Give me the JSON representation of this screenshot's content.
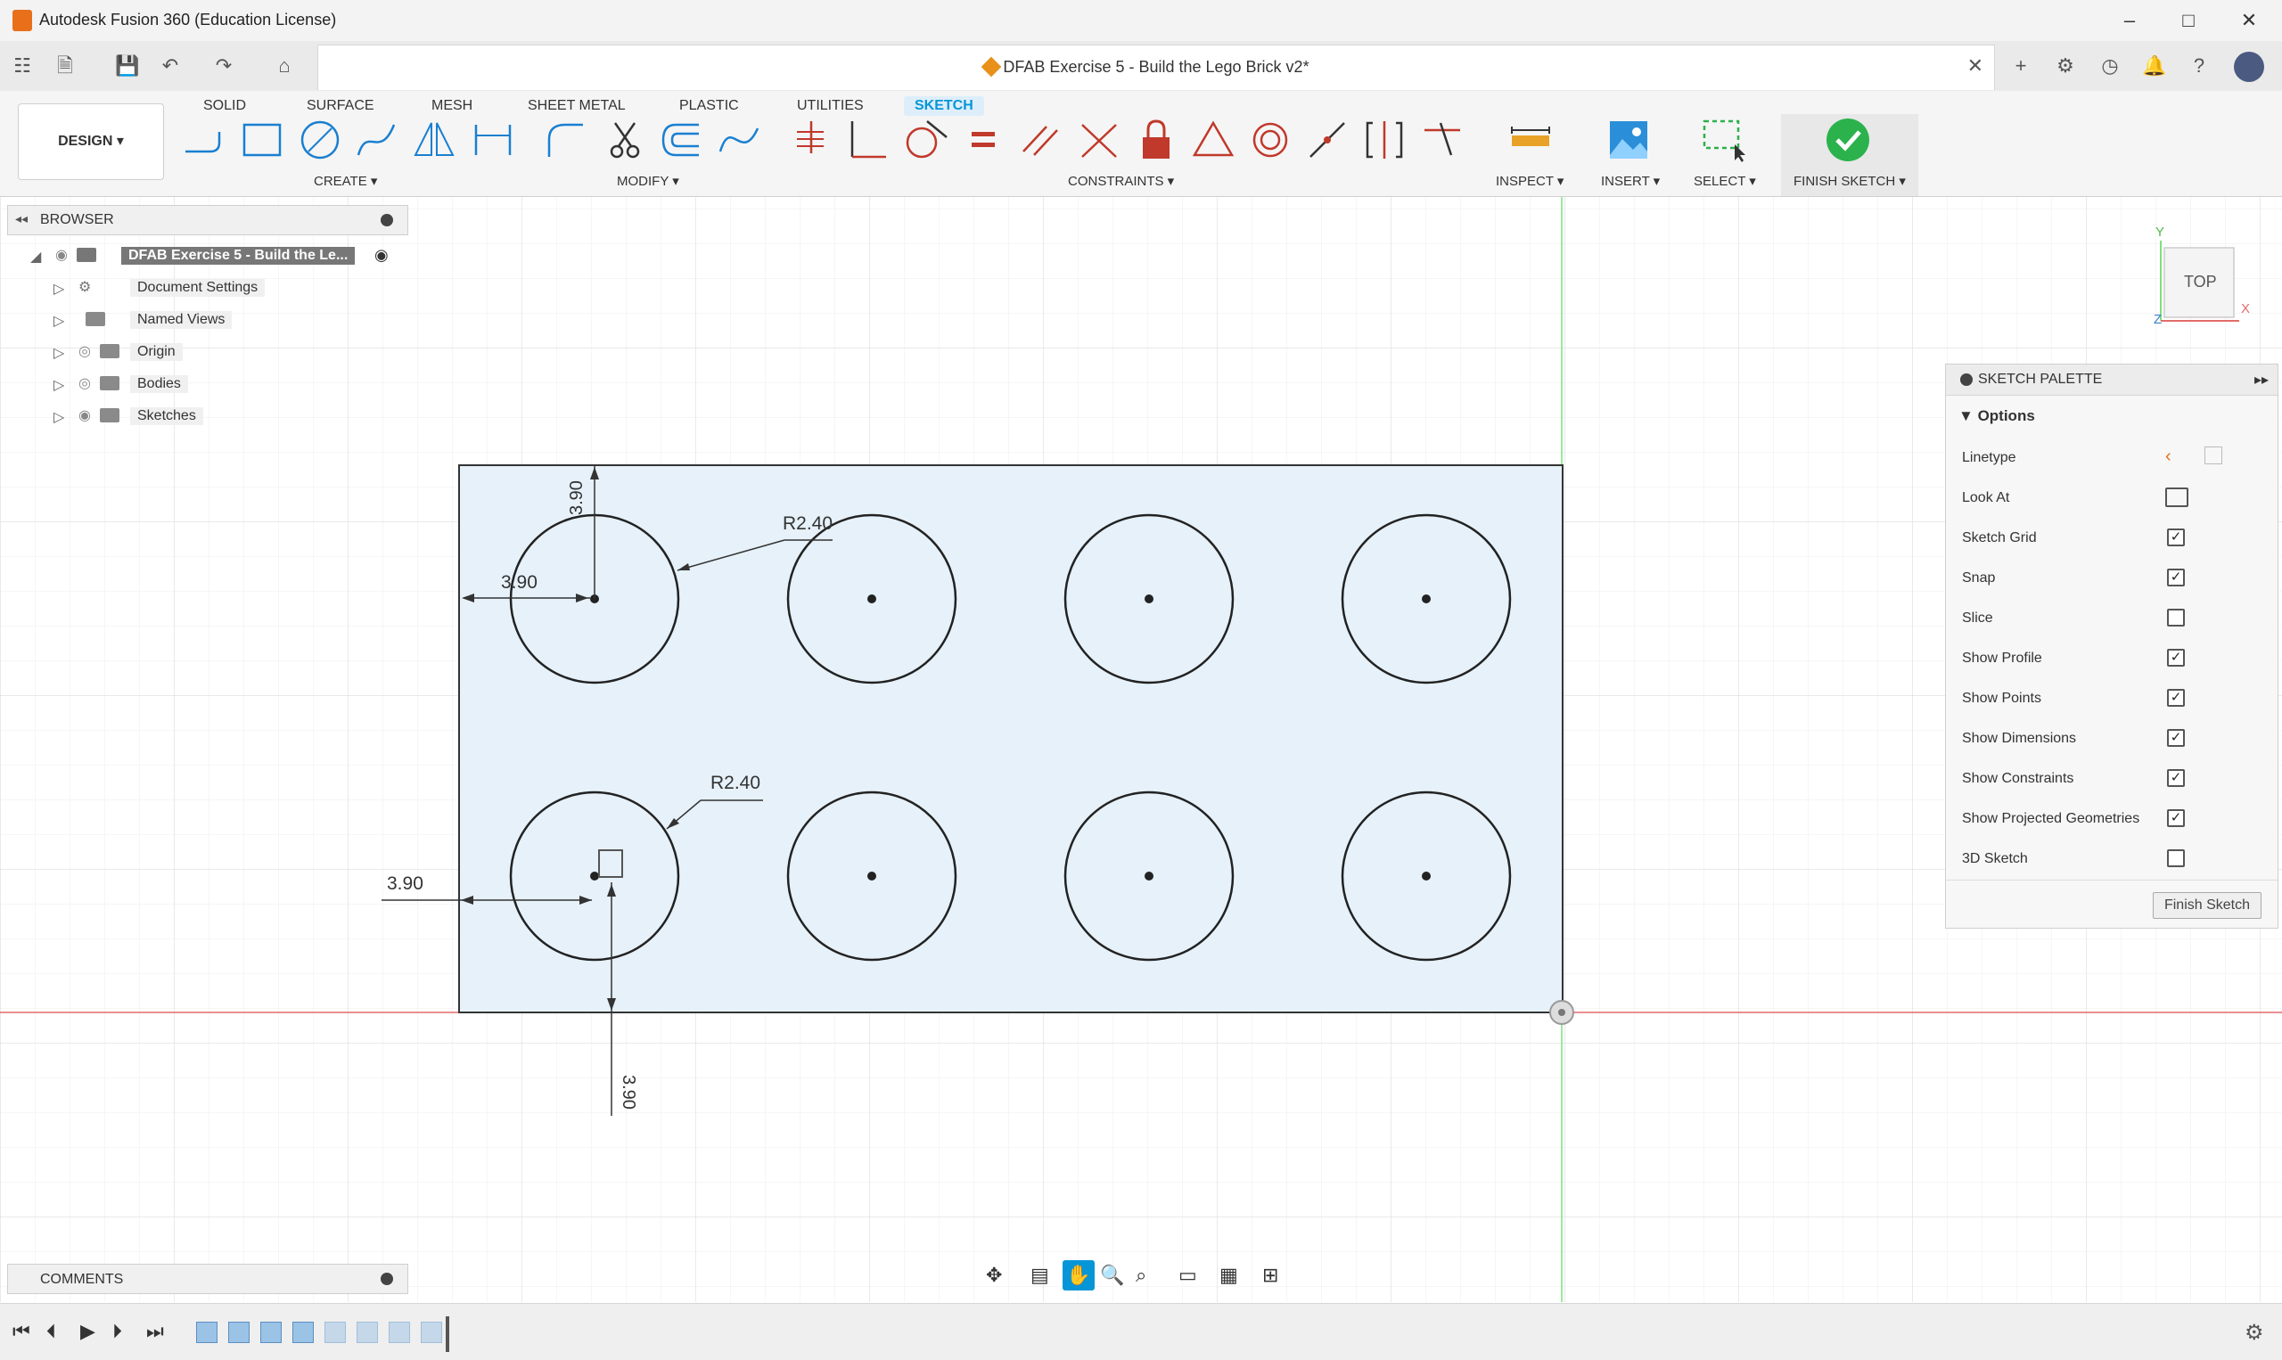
{
  "window": {
    "title": "Autodesk Fusion 360 (Education License)",
    "controls": [
      "minimize-icon",
      "maximize-icon",
      "close-icon"
    ]
  },
  "document": {
    "tab_title": "DFAB Exercise 5 - Build the Lego Brick v2*"
  },
  "workspace": {
    "design_label": "DESIGN ▾",
    "tabs": [
      "SOLID",
      "SURFACE",
      "MESH",
      "SHEET METAL",
      "PLASTIC",
      "UTILITIES",
      "SKETCH"
    ],
    "active_tab": "SKETCH"
  },
  "ribbon_groups": {
    "create": "CREATE ▾",
    "modify": "MODIFY ▾",
    "constraints": "CONSTRAINTS ▾",
    "inspect": "INSPECT ▾",
    "insert": "INSERT ▾",
    "select": "SELECT ▾",
    "finish": "FINISH SKETCH ▾"
  },
  "browser": {
    "header": "BROWSER",
    "root": "DFAB Exercise 5 - Build the Le...",
    "items": [
      "Document Settings",
      "Named Views",
      "Origin",
      "Bodies",
      "Sketches"
    ]
  },
  "comments": {
    "header": "COMMENTS"
  },
  "viewcube": {
    "face": "TOP",
    "axis_y": "Y",
    "axis_x": "X",
    "axis_z": "Z"
  },
  "sketch": {
    "dims": {
      "top_offset": "3.90",
      "left_offset_top": "3.90",
      "radius_top": "R2.40",
      "radius_bottom": "R2.40",
      "left_offset_bottom": "3.90",
      "bottom_offset": "3.90"
    }
  },
  "palette": {
    "title": "SKETCH PALETTE",
    "section": "Options",
    "rows": [
      {
        "label": "Linetype",
        "kind": "icons"
      },
      {
        "label": "Look At",
        "kind": "icon"
      },
      {
        "label": "Sketch Grid",
        "checked": true
      },
      {
        "label": "Snap",
        "checked": true
      },
      {
        "label": "Slice",
        "checked": false
      },
      {
        "label": "Show Profile",
        "checked": true
      },
      {
        "label": "Show Points",
        "checked": true
      },
      {
        "label": "Show Dimensions",
        "checked": true
      },
      {
        "label": "Show Constraints",
        "checked": true
      },
      {
        "label": "Show Projected Geometries",
        "checked": true
      },
      {
        "label": "3D Sketch",
        "checked": false
      }
    ],
    "finish_button": "Finish Sketch"
  },
  "colors": {
    "accent": "#0696d7",
    "sketch_fill": "#e6f1f9",
    "axis_red": "#e36b6b",
    "axis_green": "#7ee07e",
    "finish_green": "#2bb24c"
  }
}
